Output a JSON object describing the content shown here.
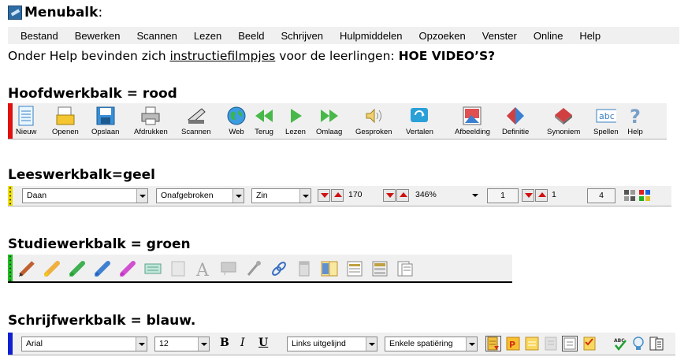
{
  "menubalk": {
    "title": "Menubalk",
    "colon": ":",
    "items": [
      "Bestand",
      "Bewerken",
      "Scannen",
      "Lezen",
      "Beeld",
      "Schrijven",
      "Hulpmiddelen",
      "Opzoeken",
      "Venster",
      "Online",
      "Help"
    ]
  },
  "info": {
    "before": "Onder Help bevinden zich ",
    "link": "instructiefilmpjes",
    "after": " voor de leerlingen: ",
    "bold": "HOE VIDEO’S?"
  },
  "hoofdwerkbalk": {
    "title": "Hoofdwerkbalk = rood",
    "strip_color": "#e01010",
    "buttons": [
      {
        "label": "Nieuw",
        "icon": "new-document-icon"
      },
      {
        "label": "Openen",
        "icon": "open-folder-icon"
      },
      {
        "label": "Opslaan",
        "icon": "save-icon"
      },
      {
        "label": "Afdrukken",
        "icon": "printer-icon"
      },
      {
        "label": "Scannen",
        "icon": "scanner-icon"
      },
      {
        "label": "Web",
        "icon": "globe-icon"
      },
      {
        "label": "Terug",
        "icon": "back-icon"
      },
      {
        "label": "Lezen",
        "icon": "play-icon"
      },
      {
        "label": "Omlaag",
        "icon": "forward-icon"
      },
      {
        "label": "Gesproken",
        "icon": "speaker-icon"
      },
      {
        "label": "Vertalen",
        "icon": "translate-icon"
      },
      {
        "label": "Afbeelding",
        "icon": "image-icon"
      },
      {
        "label": "Definitie",
        "icon": "definition-book-icon"
      },
      {
        "label": "Synoniem",
        "icon": "synonym-book-icon"
      },
      {
        "label": "Spellen",
        "icon": "spelling-abc-icon"
      },
      {
        "label": "Help",
        "icon": "help-question-icon"
      }
    ]
  },
  "leeswerkbalk": {
    "title": "Leeswerkbalk=geel",
    "strip_color": "#f0e000",
    "combo_voice": "Daan",
    "combo_mode": "Onafgebroken",
    "combo_unit": "Zin",
    "speed": "170",
    "zoom": "346%",
    "page_from": "1",
    "page_current": "1",
    "page_to": "4"
  },
  "studiewerkbalk": {
    "title": "Studiewerkbalk = groen",
    "strip_color": "#20c020",
    "icons": [
      "pencil-highlighter-icon",
      "yellow-highlighter-icon",
      "green-highlighter-icon",
      "blue-highlighter-icon",
      "pink-highlighter-icon",
      "collect-highlights-icon",
      "note-icon",
      "text-note-icon",
      "comment-icon",
      "voice-note-icon",
      "link-icon",
      "eraser-icon",
      "vocabulary-icon",
      "outline-icon",
      "extract-icon",
      "columns-icon"
    ]
  },
  "schrijfwerkbalk": {
    "title": "Schrijfwerkbalk = blauw.",
    "strip_color": "#1020d0",
    "font": "Arial",
    "size": "12",
    "bold": "B",
    "italic": "I",
    "underline": "U",
    "align": "Links uitgelijnd",
    "spacing": "Enkele spatiëring",
    "icons": [
      "echo-icon",
      "word-prediction-icon",
      "highlight-write-icon",
      "gray-page-icon",
      "frame-icon",
      "checklist-icon",
      "spellcheck-icon",
      "idea-icon",
      "columns-icon"
    ]
  }
}
